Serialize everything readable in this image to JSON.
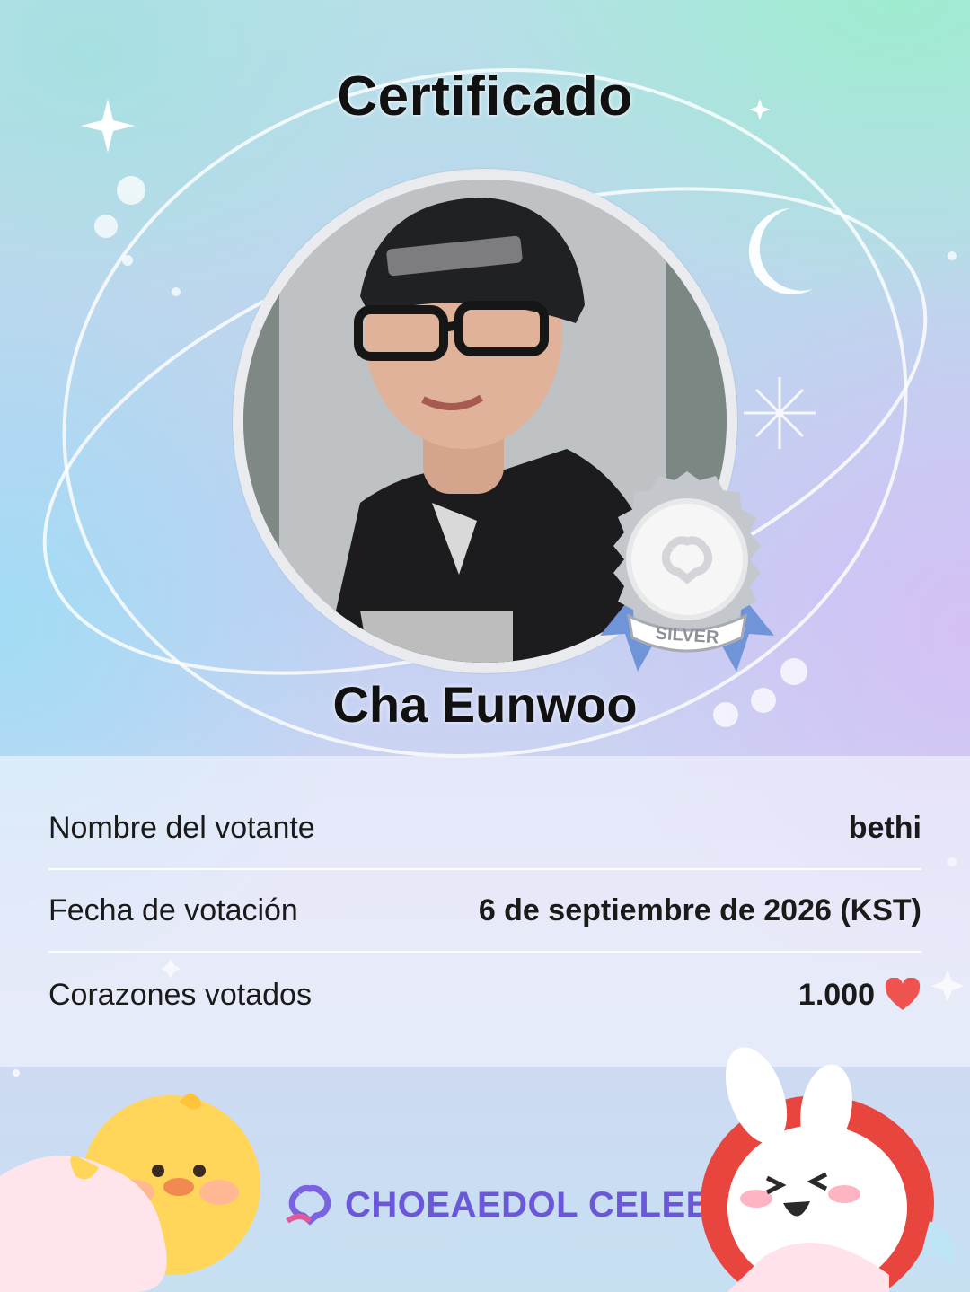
{
  "certificate": {
    "title": "Certificado",
    "idol_name": "Cha Eunwoo",
    "badge_label": "SILVER",
    "badge_color": "#c4c7cc",
    "ribbon_color": "#6f95d8"
  },
  "info": {
    "rows": [
      {
        "label": "Nombre del votante",
        "value": "bethi"
      },
      {
        "label": "Fecha de votación",
        "value": "6 de septiembre de 2026 (KST)"
      },
      {
        "label": "Corazones votados",
        "value": "1.000",
        "icon": "heart-icon"
      }
    ],
    "heart_color": "#ef5350"
  },
  "footer": {
    "brand": "CHOEAEDOL CELEB",
    "brand_color": "#6b58d8"
  }
}
